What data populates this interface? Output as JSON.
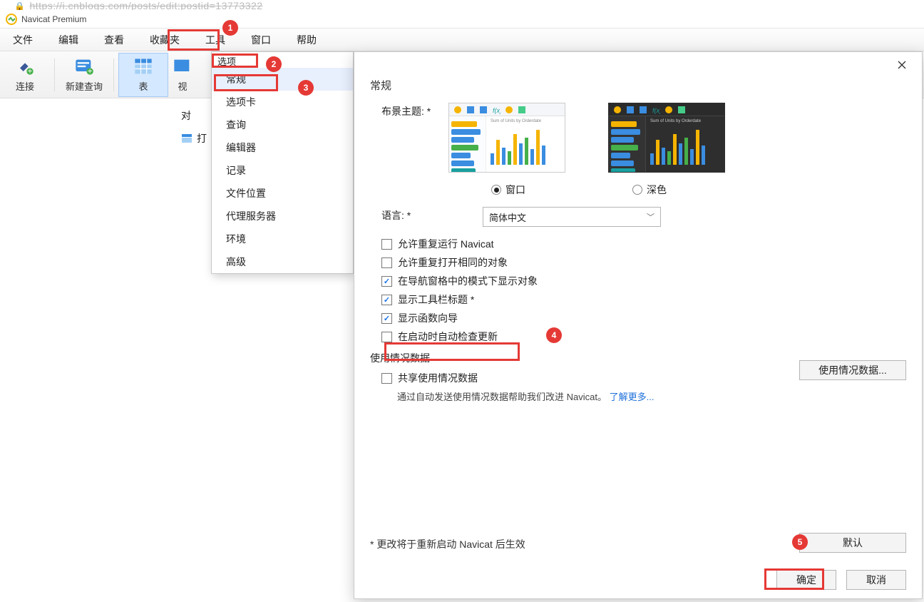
{
  "url_fragment": "https://i.cnblogs.com/posts/edit;postid=13773322",
  "app_title": "Navicat Premium",
  "menubar": [
    "文件",
    "编辑",
    "查看",
    "收藏夹",
    "工具",
    "窗口",
    "帮助"
  ],
  "toolbar": {
    "connect": "连接",
    "newquery": "新建查询",
    "table": "表",
    "view_cut": "视"
  },
  "left_cut1": "对",
  "left_cut2": "打",
  "options_menu": {
    "header": "选项",
    "items": [
      "常规",
      "选项卡",
      "查询",
      "编辑器",
      "记录",
      "文件位置",
      "代理服务器",
      "环境",
      "高级"
    ]
  },
  "dialog": {
    "heading": "常规",
    "theme_label": "布景主题: *",
    "radio_window": "窗口",
    "radio_dark": "深色",
    "lang_label": "语言: *",
    "lang_value": "简体中文",
    "checks": {
      "allow_dup_run": "允许重复运行 Navicat",
      "allow_dup_open": "允许重复打开相同的对象",
      "show_schema": "在导航窗格中的模式下显示对象",
      "show_toolbar_titles": "显示工具栏标题 *",
      "show_func_wizard": "显示函数向导",
      "check_update": "在启动时自动检查更新"
    },
    "usage_heading": "使用情况数据",
    "usage_check": "共享使用情况数据",
    "usage_help_pre": "通过自动发送使用情况数据帮助我们改进 Navicat。",
    "usage_help_link": "了解更多...",
    "usage_btn": "使用情况数据...",
    "footnote": "* 更改将于重新启动 Navicat 后生效",
    "default_btn": "默认",
    "ok_btn": "确定",
    "cancel_btn": "取消"
  },
  "badges": [
    "1",
    "2",
    "3",
    "4",
    "5"
  ]
}
